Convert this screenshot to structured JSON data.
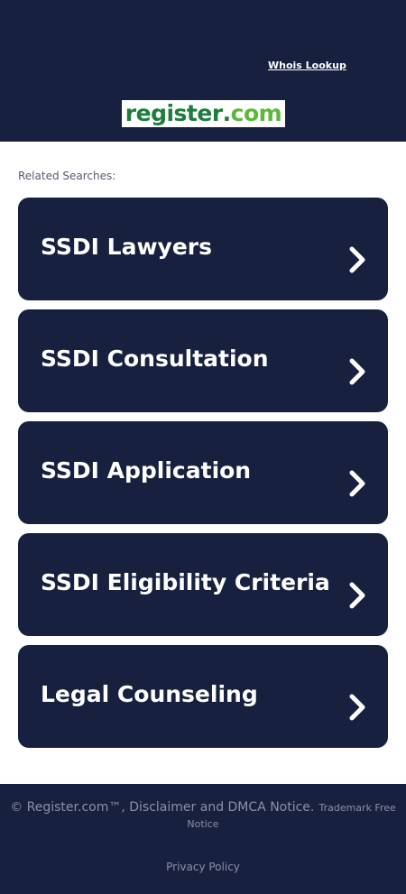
{
  "header": {
    "whois_label": "Whois Lookup",
    "logo": {
      "part1": "register",
      "part2": ".",
      "part3": "com",
      "mark": "®"
    }
  },
  "related_searches_label": "Related Searches:",
  "searches": [
    {
      "label": "SSDI Lawyers"
    },
    {
      "label": "SSDI Consultation"
    },
    {
      "label": "SSDI Application"
    },
    {
      "label": "SSDI Eligibility Criteria"
    },
    {
      "label": "Legal Counseling"
    }
  ],
  "footer": {
    "copyright": "© Register.com™, Disclaimer and DMCA Notice.",
    "trademark": "Trademark Free Notice",
    "privacy": "Privacy Policy"
  },
  "colors": {
    "navy": "#17203f",
    "logo_green_dark": "#1d7d3c",
    "logo_green_light": "#5cb83a",
    "footer_text": "#8a90a8"
  },
  "icons": {
    "card_arrow": "chevron-right-icon"
  }
}
